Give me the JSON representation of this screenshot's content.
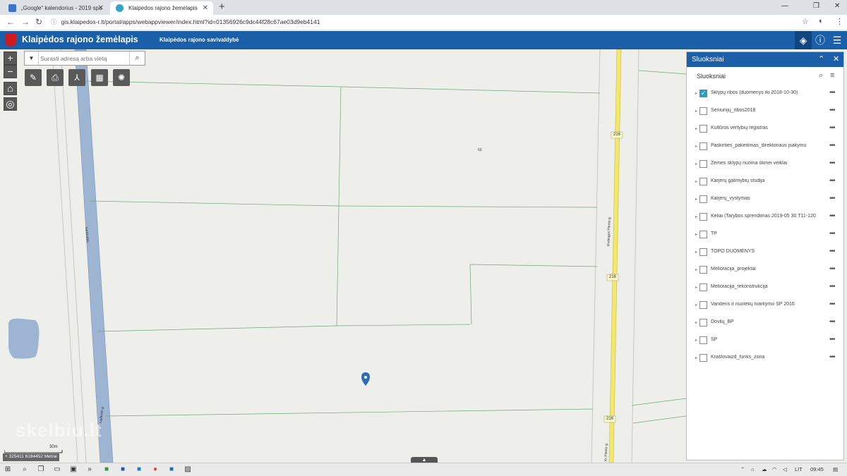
{
  "browser": {
    "tabs": [
      {
        "title": "„Google“ kalendorius - 2019 spa",
        "active": false,
        "favicon_color": "#3f72c9"
      },
      {
        "title": "Klaipėdos rajono žemėlapis",
        "active": true,
        "favicon_color": "#33a4c8"
      }
    ],
    "url": "gis.klaipedos-r.lt/portal/apps/webappviewer/index.html?id=01356926c9dc44f28c67ae03d9eb4141"
  },
  "app": {
    "title": "Klaipėdos rajono žemėlapis",
    "subtitle": "Klaipėdos rajono savivaldybė"
  },
  "map": {
    "search_placeholder": "Surasti adresą arba vietą",
    "road_number": "216",
    "parcel_label": "63",
    "road_name_left": "Iverbudas",
    "road_name_left_lower": "Ivalbudo g.",
    "road_name_right": "Kretingos Plento g.",
    "road_name_right_lower": "Kr Plento g.",
    "scale_label": "30m",
    "coordinates": "325411 6184452 Metrai",
    "watermark": "skelbiu.lt"
  },
  "panel": {
    "header": "Sluoksniai",
    "sub_title": "Sluoksniai",
    "layers": [
      {
        "label": "Sklypų ribos (duomenys iki 2018-10-30)",
        "checked": true
      },
      {
        "label": "Seniunijų_ribos2018",
        "checked": false
      },
      {
        "label": "Kultūros vertybių registras",
        "checked": false
      },
      {
        "label": "Paskirties_pakeitimas_direktoriaus įsakymu",
        "checked": false
      },
      {
        "label": "Žemės sklypų nuoma ūkinei veiklai",
        "checked": false
      },
      {
        "label": "Karjerų galimybių studija",
        "checked": false
      },
      {
        "label": "Karjerų_vystymas",
        "checked": false
      },
      {
        "label": "Keliai (Tarybos sprendimas 2019-05 30 T11-120",
        "checked": false
      },
      {
        "label": "TP",
        "checked": false
      },
      {
        "label": "TOPO DUOMENYS",
        "checked": false
      },
      {
        "label": "Melioracija_projektai",
        "checked": false
      },
      {
        "label": "Melioracija_rekonstrukcija",
        "checked": false
      },
      {
        "label": "Vandens ir nuotekų tvarkymo SP 2016",
        "checked": false
      },
      {
        "label": "Dovilų_BP",
        "checked": false
      },
      {
        "label": "SP",
        "checked": false
      },
      {
        "label": "Kraštovaizd_funks_zona",
        "checked": false
      }
    ]
  },
  "taskbar": {
    "lang": "LIT",
    "time": "09:45"
  },
  "colors": {
    "header_blue": "#1b5fa8",
    "road_yellow": "#f2e86a",
    "water_blue": "#9db5d3",
    "parcel_green": "#6fa77a"
  }
}
